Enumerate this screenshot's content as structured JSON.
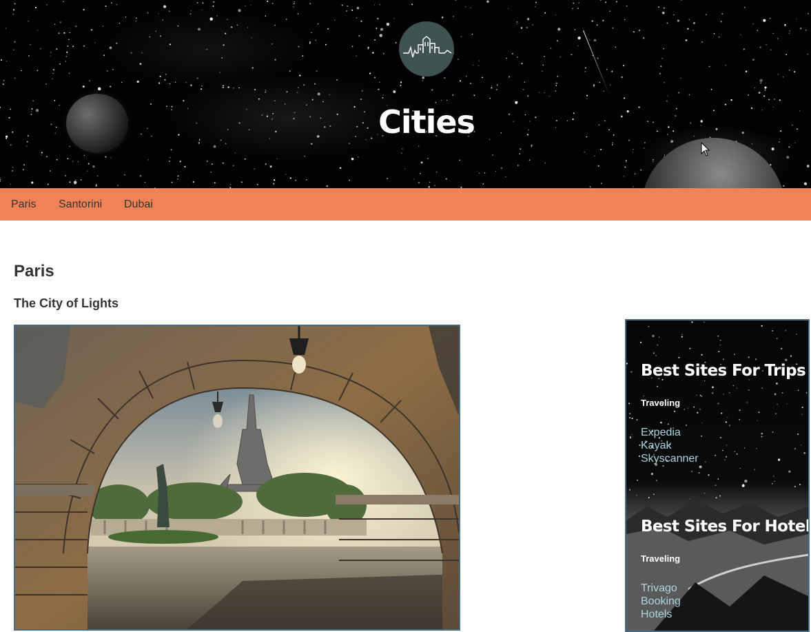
{
  "header": {
    "site_title": "Cities",
    "logo_icon": "city-skyline-icon"
  },
  "nav": {
    "links": [
      "Paris",
      "Santorini",
      "Dubai"
    ]
  },
  "main": {
    "title": "Paris",
    "subtitle": "The City of Lights"
  },
  "sidebar": {
    "sections": [
      {
        "heading": "Best Sites For Trips",
        "subheading": "Traveling",
        "links": [
          "Expedia",
          "Kayak",
          "Skyscanner"
        ]
      },
      {
        "heading": "Best Sites For Hotels",
        "subheading": "Traveling",
        "links": [
          "Trivago",
          "Booking",
          "Hotels"
        ]
      }
    ]
  },
  "colors": {
    "nav_background": "#ef8357",
    "logo_background": "#3e5352",
    "frame_border": "#466c86",
    "sidebar_link": "#a9d6e0"
  }
}
